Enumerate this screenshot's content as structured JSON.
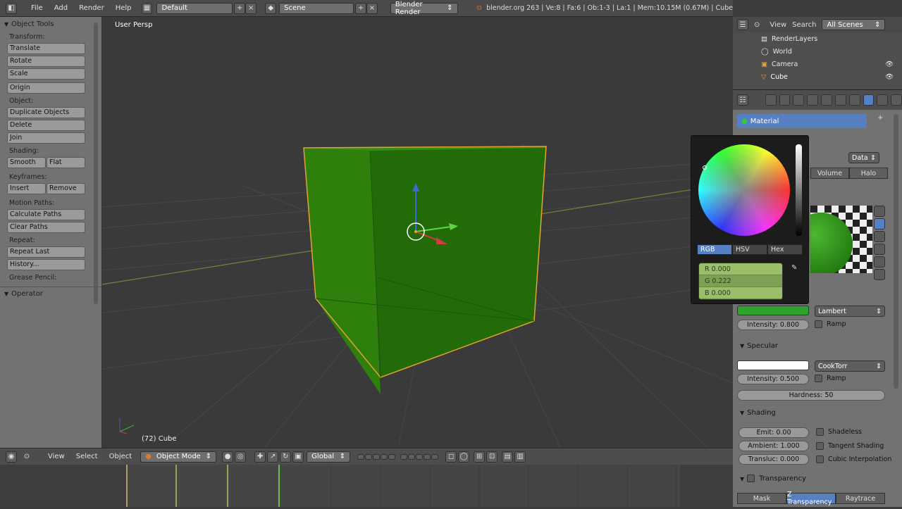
{
  "topbar": {
    "menus": [
      "File",
      "Add",
      "Render",
      "Help"
    ],
    "layout": "Default",
    "scene": "Scene",
    "engine": "Blender Render",
    "stats": "blender.org 263 | Ve:8 | Fa:6 | Ob:1-3 | La:1 | Mem:10.15M (0.67M) | Cube"
  },
  "toolshelf": {
    "title": "Object Tools",
    "transform_label": "Transform:",
    "translate": "Translate",
    "rotate": "Rotate",
    "scale": "Scale",
    "origin": "Origin",
    "object_label": "Object:",
    "duplicate": "Duplicate Objects",
    "delete": "Delete",
    "join": "Join",
    "shading_label": "Shading:",
    "smooth": "Smooth",
    "flat": "Flat",
    "keyframes_label": "Keyframes:",
    "insert": "Insert",
    "remove": "Remove",
    "motion_label": "Motion Paths:",
    "calc_paths": "Calculate Paths",
    "clear_paths": "Clear Paths",
    "repeat_label": "Repeat:",
    "repeat_last": "Repeat Last",
    "history": "History...",
    "grease_label": "Grease Pencil:",
    "operator": "Operator"
  },
  "viewport": {
    "view_name": "User Persp",
    "object_label": "(72) Cube"
  },
  "viewheader": {
    "menus": [
      "View",
      "Select",
      "Object"
    ],
    "mode": "Object Mode",
    "orientation": "Global"
  },
  "outliner": {
    "view": "View",
    "search": "Search",
    "scope": "All Scenes",
    "items": [
      "RenderLayers",
      "World",
      "Camera",
      "Cube"
    ]
  },
  "props": {
    "material_name": "Material",
    "data_label": "Data",
    "tabs": [
      "Volume",
      "Halo"
    ],
    "diffuse_shader": "Lambert",
    "diffuse_intensity": "Intensity: 0.800",
    "ramp": "Ramp",
    "specular_title": "Specular",
    "spec_shader": "CookTorr",
    "spec_intensity": "Intensity: 0.500",
    "hardness": "Hardness: 50",
    "shading_title": "Shading",
    "emit": "Emit: 0.00",
    "ambient": "Ambient: 1.000",
    "translucency": "Transluc: 0.000",
    "shadeless": "Shadeless",
    "tangent": "Tangent Shading",
    "cubic": "Cubic Interpolation",
    "transparency_title": "Transparency",
    "trans_tabs": [
      "Mask",
      "Z Transparency",
      "Raytrace"
    ]
  },
  "colorpicker": {
    "modes": [
      "RGB",
      "HSV",
      "Hex"
    ],
    "r": "R 0.000",
    "g": "G 0.222",
    "b": "B 0.000"
  },
  "colors": {
    "cube_face": "#2a7a0a",
    "selection_outline": "#e8a030",
    "accent_blue": "#5680c2",
    "diffuse_swatch": "#2ea32e"
  }
}
